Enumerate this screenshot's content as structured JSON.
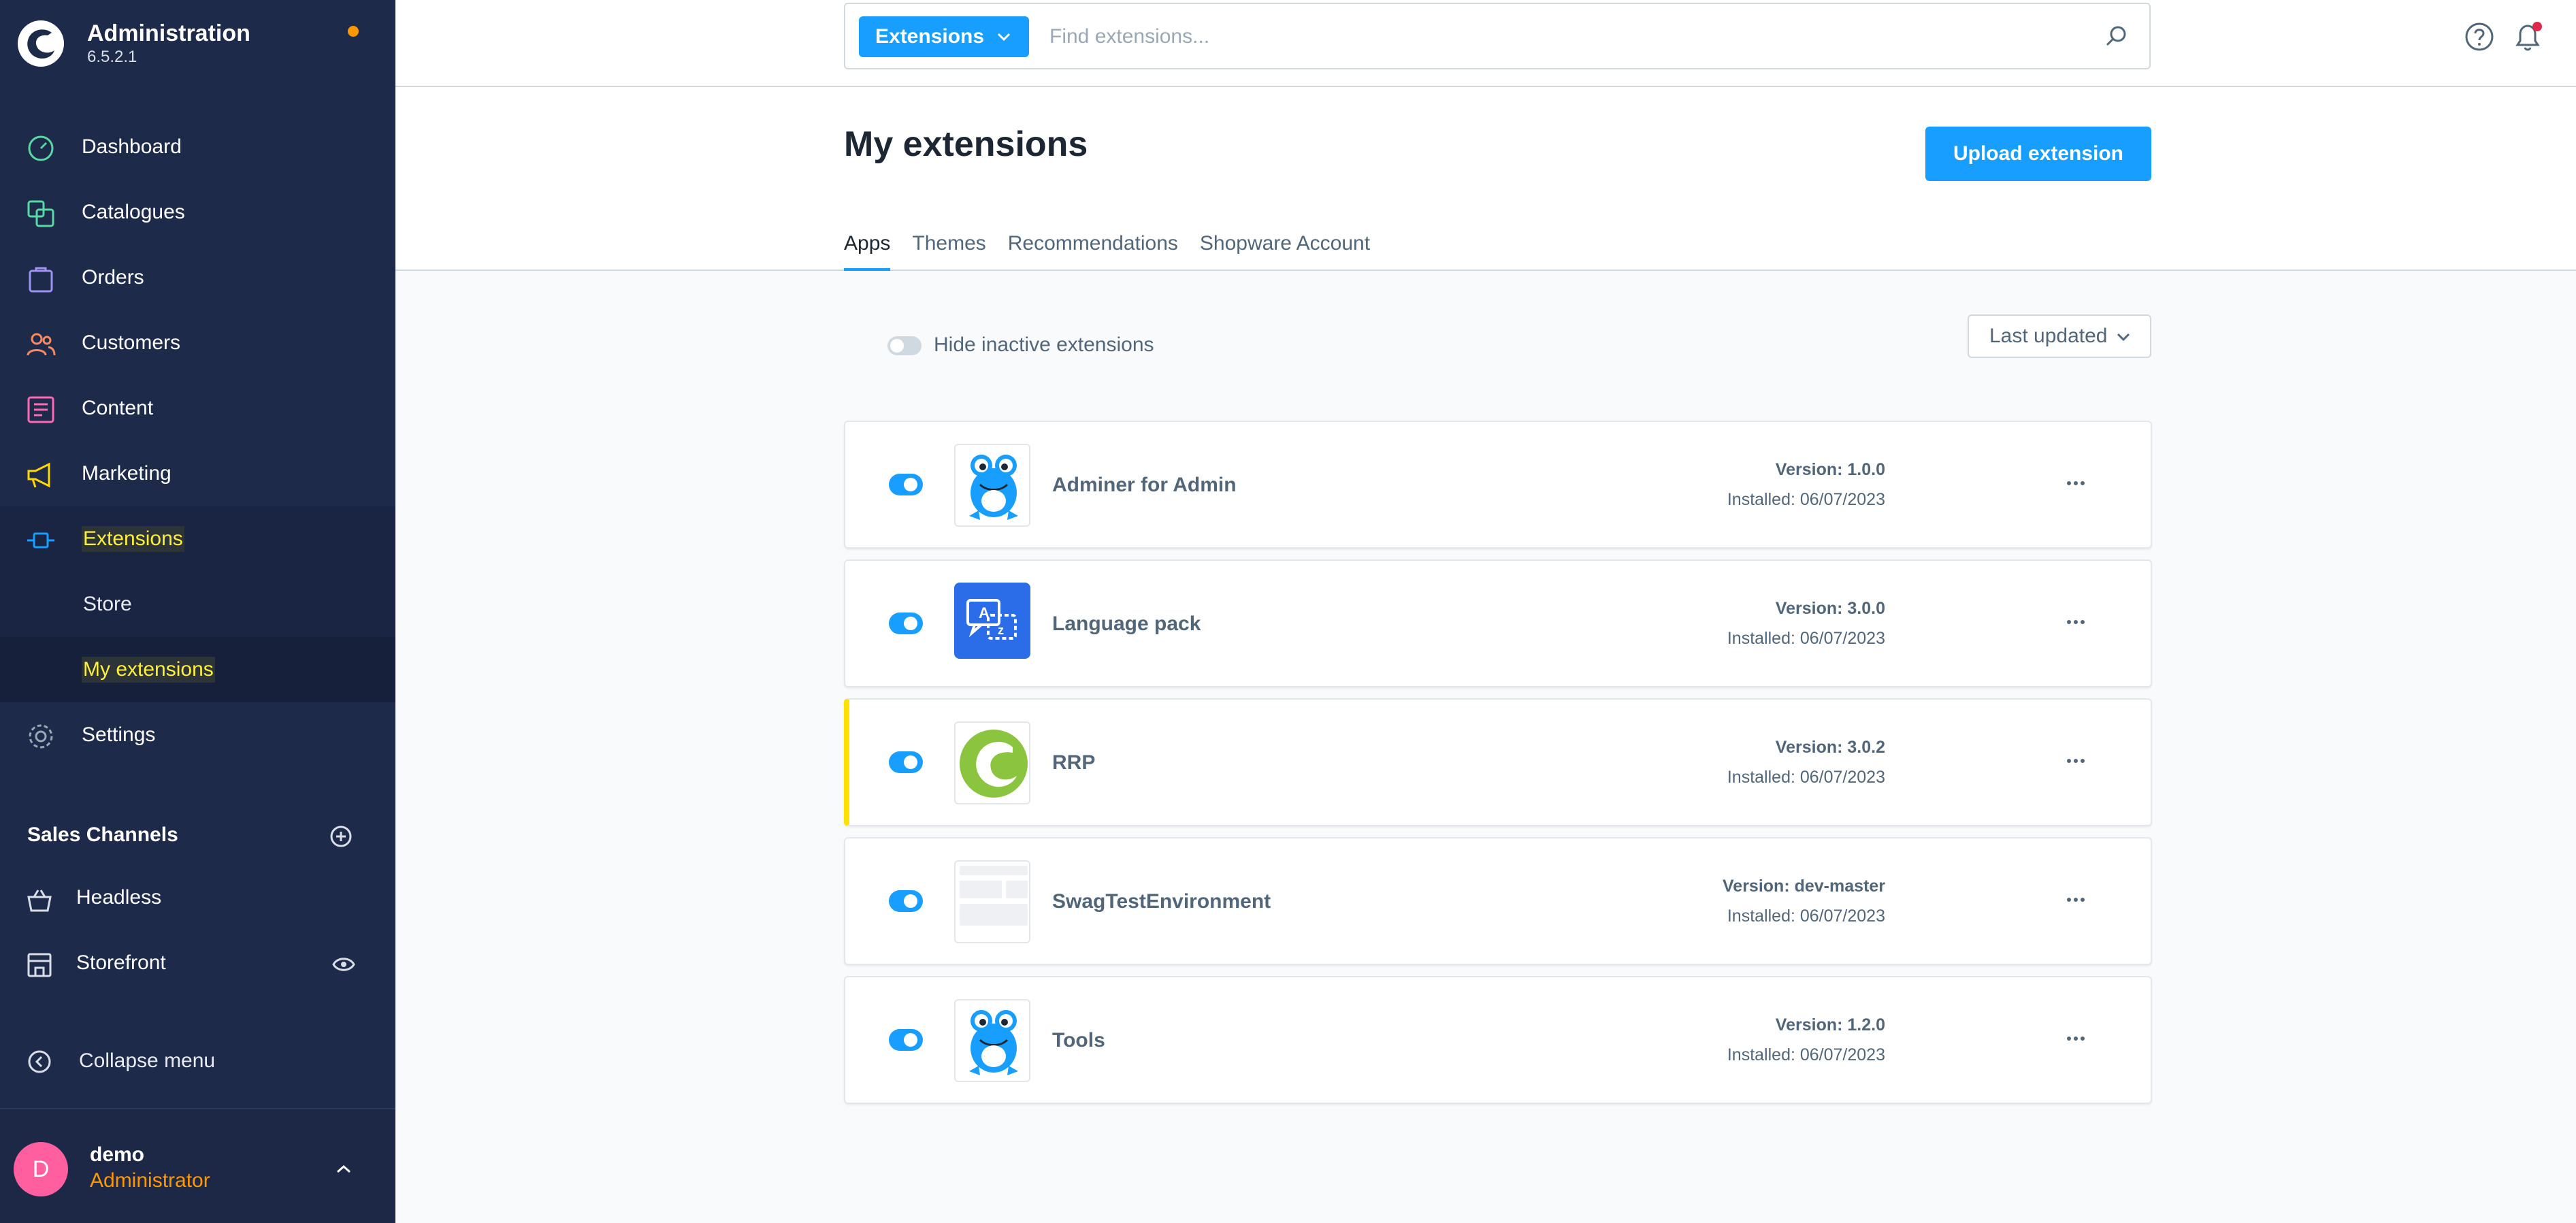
{
  "brand": {
    "title": "Administration",
    "version": "6.5.2.1"
  },
  "nav": [
    {
      "label": "Dashboard",
      "icon": "dashboard-icon",
      "color": "#57d9a3"
    },
    {
      "label": "Catalogues",
      "icon": "catalogues-icon",
      "color": "#57d9a3"
    },
    {
      "label": "Orders",
      "icon": "orders-icon",
      "color": "#a092f0"
    },
    {
      "label": "Customers",
      "icon": "customers-icon",
      "color": "#f88962"
    },
    {
      "label": "Content",
      "icon": "content-icon",
      "color": "#ff68b4"
    },
    {
      "label": "Marketing",
      "icon": "marketing-icon",
      "color": "#ffd700"
    },
    {
      "label": "Extensions",
      "icon": "extensions-icon",
      "color": "#189eff"
    },
    {
      "label": "Store"
    },
    {
      "label": "My extensions"
    },
    {
      "label": "Settings",
      "icon": "settings-icon",
      "color": "#9aa8b5"
    }
  ],
  "sales_channels": {
    "heading": "Sales Channels",
    "items": [
      {
        "label": "Headless"
      },
      {
        "label": "Storefront"
      }
    ]
  },
  "collapse_label": "Collapse menu",
  "user": {
    "initial": "D",
    "name": "demo",
    "role": "Administrator"
  },
  "search": {
    "type_label": "Extensions",
    "placeholder": "Find extensions..."
  },
  "page": {
    "title": "My extensions",
    "upload_label": "Upload extension",
    "tabs": [
      "Apps",
      "Themes",
      "Recommendations",
      "Shopware Account"
    ],
    "hide_inactive_label": "Hide inactive extensions",
    "sort_label": "Last updated"
  },
  "extensions": [
    {
      "name": "Adminer for Admin",
      "version": "Version: 1.0.0",
      "installed": "Installed: 06/07/2023",
      "icon": "frog-icon"
    },
    {
      "name": "Language pack",
      "version": "Version: 3.0.0",
      "installed": "Installed: 06/07/2023",
      "icon": "language-pack-icon"
    },
    {
      "name": "RRP",
      "version": "Version: 3.0.2",
      "installed": "Installed: 06/07/2023",
      "icon": "shopware-logo-icon"
    },
    {
      "name": "SwagTestEnvironment",
      "version": "Version: dev-master",
      "installed": "Installed: 06/07/2023",
      "icon": "placeholder-grid-icon"
    },
    {
      "name": "Tools",
      "version": "Version: 1.2.0",
      "installed": "Installed: 06/07/2023",
      "icon": "frog-icon"
    }
  ],
  "colors": {
    "sidebar": "#1e2a4a",
    "accent": "#189eff",
    "highlight": "#ffe100",
    "user_role": "#ff9800"
  }
}
